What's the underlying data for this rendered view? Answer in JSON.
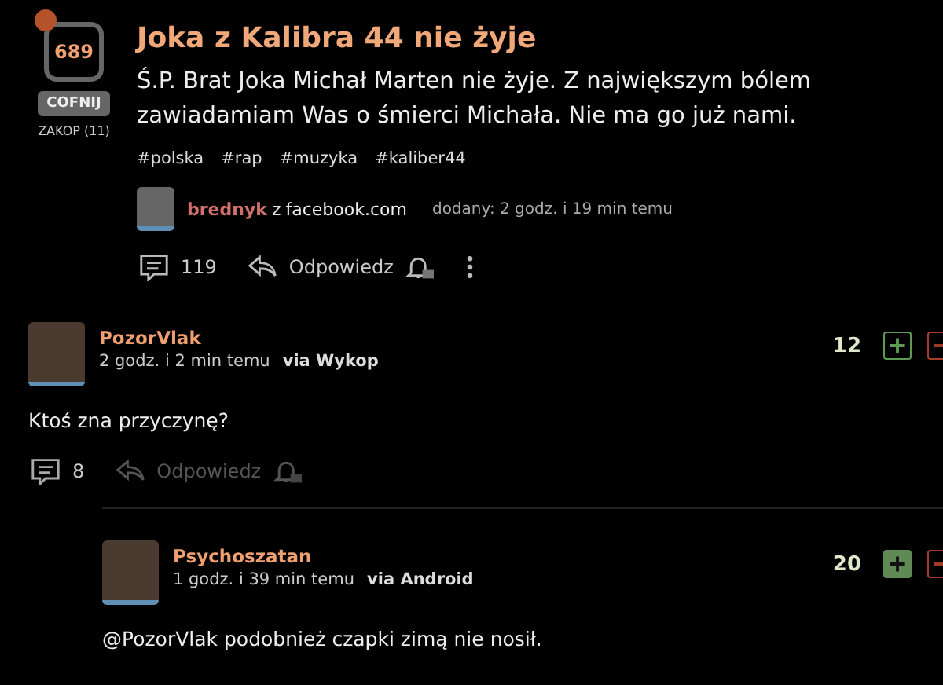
{
  "post": {
    "score": "689",
    "undo_button": "COFNIJ",
    "bury_label": "ZAKOP (11)",
    "title": "Joka z Kalibra 44 nie żyje",
    "body": "Ś.P. Brat Joka Michał Marten nie żyje. Z największym bólem zawiadamiam Was o śmierci Michała. Nie ma go już nami.",
    "tags": [
      "#polska",
      "#rap",
      "#muzyka",
      "#kaliber44"
    ],
    "author": "brednyk",
    "source_prefix": "z",
    "source": "facebook.com",
    "added": "dodany: 2 godz. i 19 min temu",
    "comment_count": "119",
    "reply_label": "Odpowiedz"
  },
  "comments": [
    {
      "author": "PozorVlak",
      "time": "2 godz. i 2 min temu",
      "via": "via Wykop",
      "votes": "12",
      "upvoted": false,
      "text": "Ktoś zna przyczynę?",
      "reply_count": "8",
      "reply_label": "Odpowiedz",
      "replies": [
        {
          "author": "Psychoszatan",
          "time": "1 godz. i 39 min temu",
          "via": "via Android",
          "votes": "20",
          "upvoted": true,
          "text": "@PozorVlak podobnież czapki zimą nie nosił."
        }
      ]
    }
  ]
}
